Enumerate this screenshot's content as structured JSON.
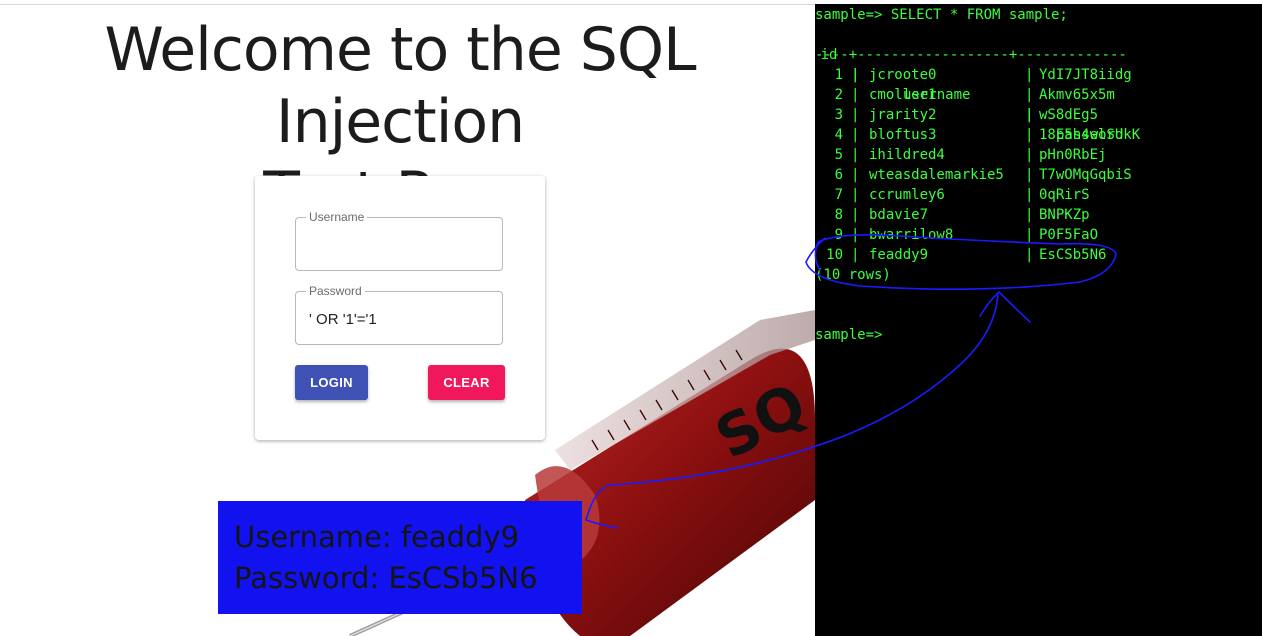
{
  "page": {
    "title_line1": "Welcome to the SQL Injection",
    "title_line2": "Test Page",
    "illustration_text": "SQ"
  },
  "login": {
    "username_label": "Username",
    "username_value": "",
    "password_label": "Password",
    "password_value": "' OR '1'='1",
    "login_button": "LOGIN",
    "clear_button": "CLEAR"
  },
  "callout": {
    "line1": "Username: feaddy9",
    "line2": "Password: EsCSb5N6"
  },
  "terminal": {
    "command": "sample=> SELECT * FROM sample;",
    "headers": {
      "id": "id",
      "username": "username",
      "password": "password"
    },
    "separator": "----+------------------+-------------",
    "rows": [
      {
        "id": "1",
        "username": "jcroote0",
        "password": "YdI7JT8iidg"
      },
      {
        "id": "2",
        "username": "cmoller1",
        "password": "Akmv65x5m"
      },
      {
        "id": "3",
        "username": "jrarity2",
        "password": "wS8dEg5"
      },
      {
        "id": "4",
        "username": "bloftus3",
        "password": "18E5h4elSUkK"
      },
      {
        "id": "5",
        "username": "ihildred4",
        "password": "pHn0RbEj"
      },
      {
        "id": "6",
        "username": "wteasdalemarkie5",
        "password": "T7wOMqGqbiS"
      },
      {
        "id": "7",
        "username": "ccrumley6",
        "password": "0qRirS"
      },
      {
        "id": "8",
        "username": "bdavie7",
        "password": "BNPKZp"
      },
      {
        "id": "9",
        "username": "bwarrilow8",
        "password": "P0F5FaO"
      },
      {
        "id": "10",
        "username": "feaddy9",
        "password": "EsCSb5N6"
      }
    ],
    "row_count": "(10 rows)",
    "prompt": "sample=>"
  },
  "colors": {
    "terminal_text": "#3bff3b",
    "terminal_bg": "#000000",
    "login_button": "#3f51b5",
    "clear_button": "#f0185a",
    "callout_bg": "#1212f0",
    "annotation_ink": "#1a1aff"
  }
}
